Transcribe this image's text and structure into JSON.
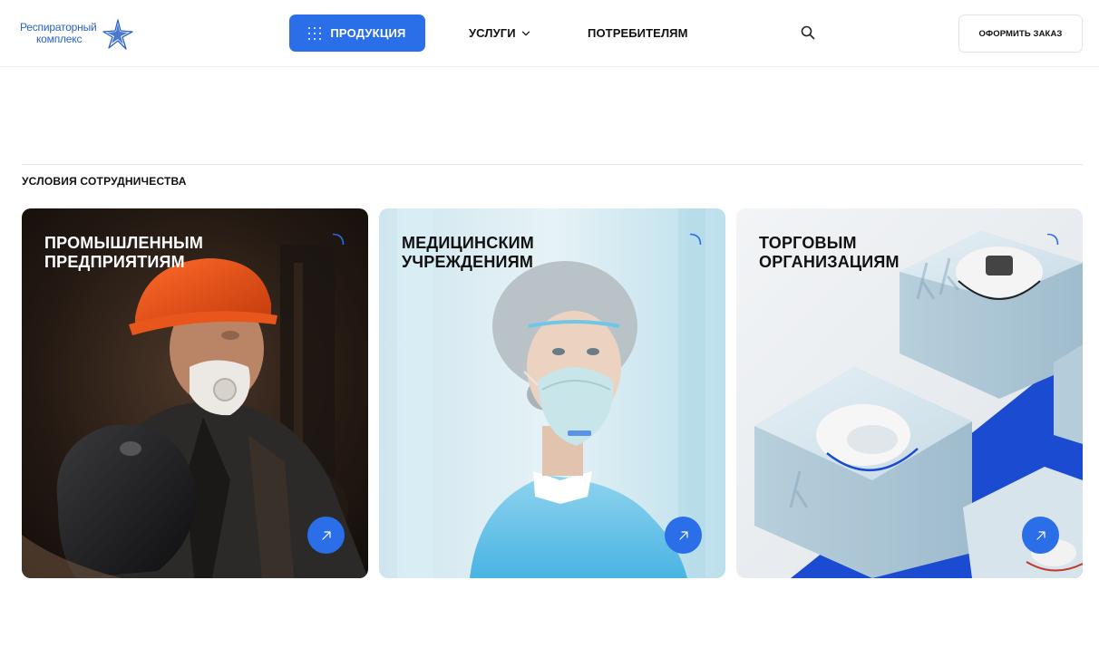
{
  "header": {
    "logo": {
      "line1": "Респираторный",
      "line2": "комплекс"
    },
    "products_label": "ПРОДУКЦИЯ",
    "services_label": "УСЛУГИ",
    "consumers_label": "ПОТРЕБИТЕЛЯМ",
    "order_label": "ОФОРМИТЬ ЗАКАЗ"
  },
  "section": {
    "title": "УСЛОВИЯ СОТРУДНИЧЕСТВА",
    "cards": [
      {
        "line1": "ПРОМЫШЛЕННЫМ",
        "line2": "ПРЕДПРИЯТИЯМ"
      },
      {
        "line1": "МЕДИЦИНСКИМ",
        "line2": "УЧРЕЖДЕНИЯМ"
      },
      {
        "line1": "ТОРГОВЫМ",
        "line2": "ОРГАНИЗАЦИЯМ"
      }
    ]
  },
  "colors": {
    "accent": "#2a6ee8",
    "logo": "#2a62c9"
  },
  "icons": [
    "grid-icon",
    "chevron-down-icon",
    "search-icon",
    "arrow-up-right-icon",
    "corner-icon",
    "star-logo-icon"
  ]
}
